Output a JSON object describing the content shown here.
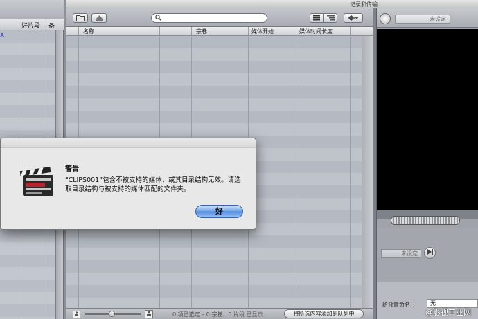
{
  "window": {
    "title": "记录和传输"
  },
  "left_pane": {
    "col1": "好片段",
    "col2": "备",
    "row1_text": "A"
  },
  "browser": {
    "search_placeholder": "",
    "columns": [
      "名称",
      "宗卷",
      "媒体开始",
      "媒体时间长度"
    ],
    "status": "0 项已选定 – 0 宗卷，0 片段 已显示",
    "add_queue_label": "将所选内容添加到队列中"
  },
  "preview": {
    "clip_name": "未设定",
    "in_out": "未设定",
    "preset_label": "给预置命名:",
    "preset_value": "无"
  },
  "dialog": {
    "title": "警告",
    "message": "“CLIPS001”包含不被支持的媒体，或其目录结构无效。请选取目录结构与被支持的媒体匹配的文件夹。",
    "ok_label": "好"
  },
  "watermark": "@影视工业网",
  "icons": {
    "search": "search-icon",
    "gear": "gear-icon",
    "eject": "eject-icon",
    "folder": "import-folder-icon",
    "list": "list-view-icon",
    "thumbnail": "thumbnail-view-icon",
    "clapperboard": "clapperboard-icon"
  }
}
